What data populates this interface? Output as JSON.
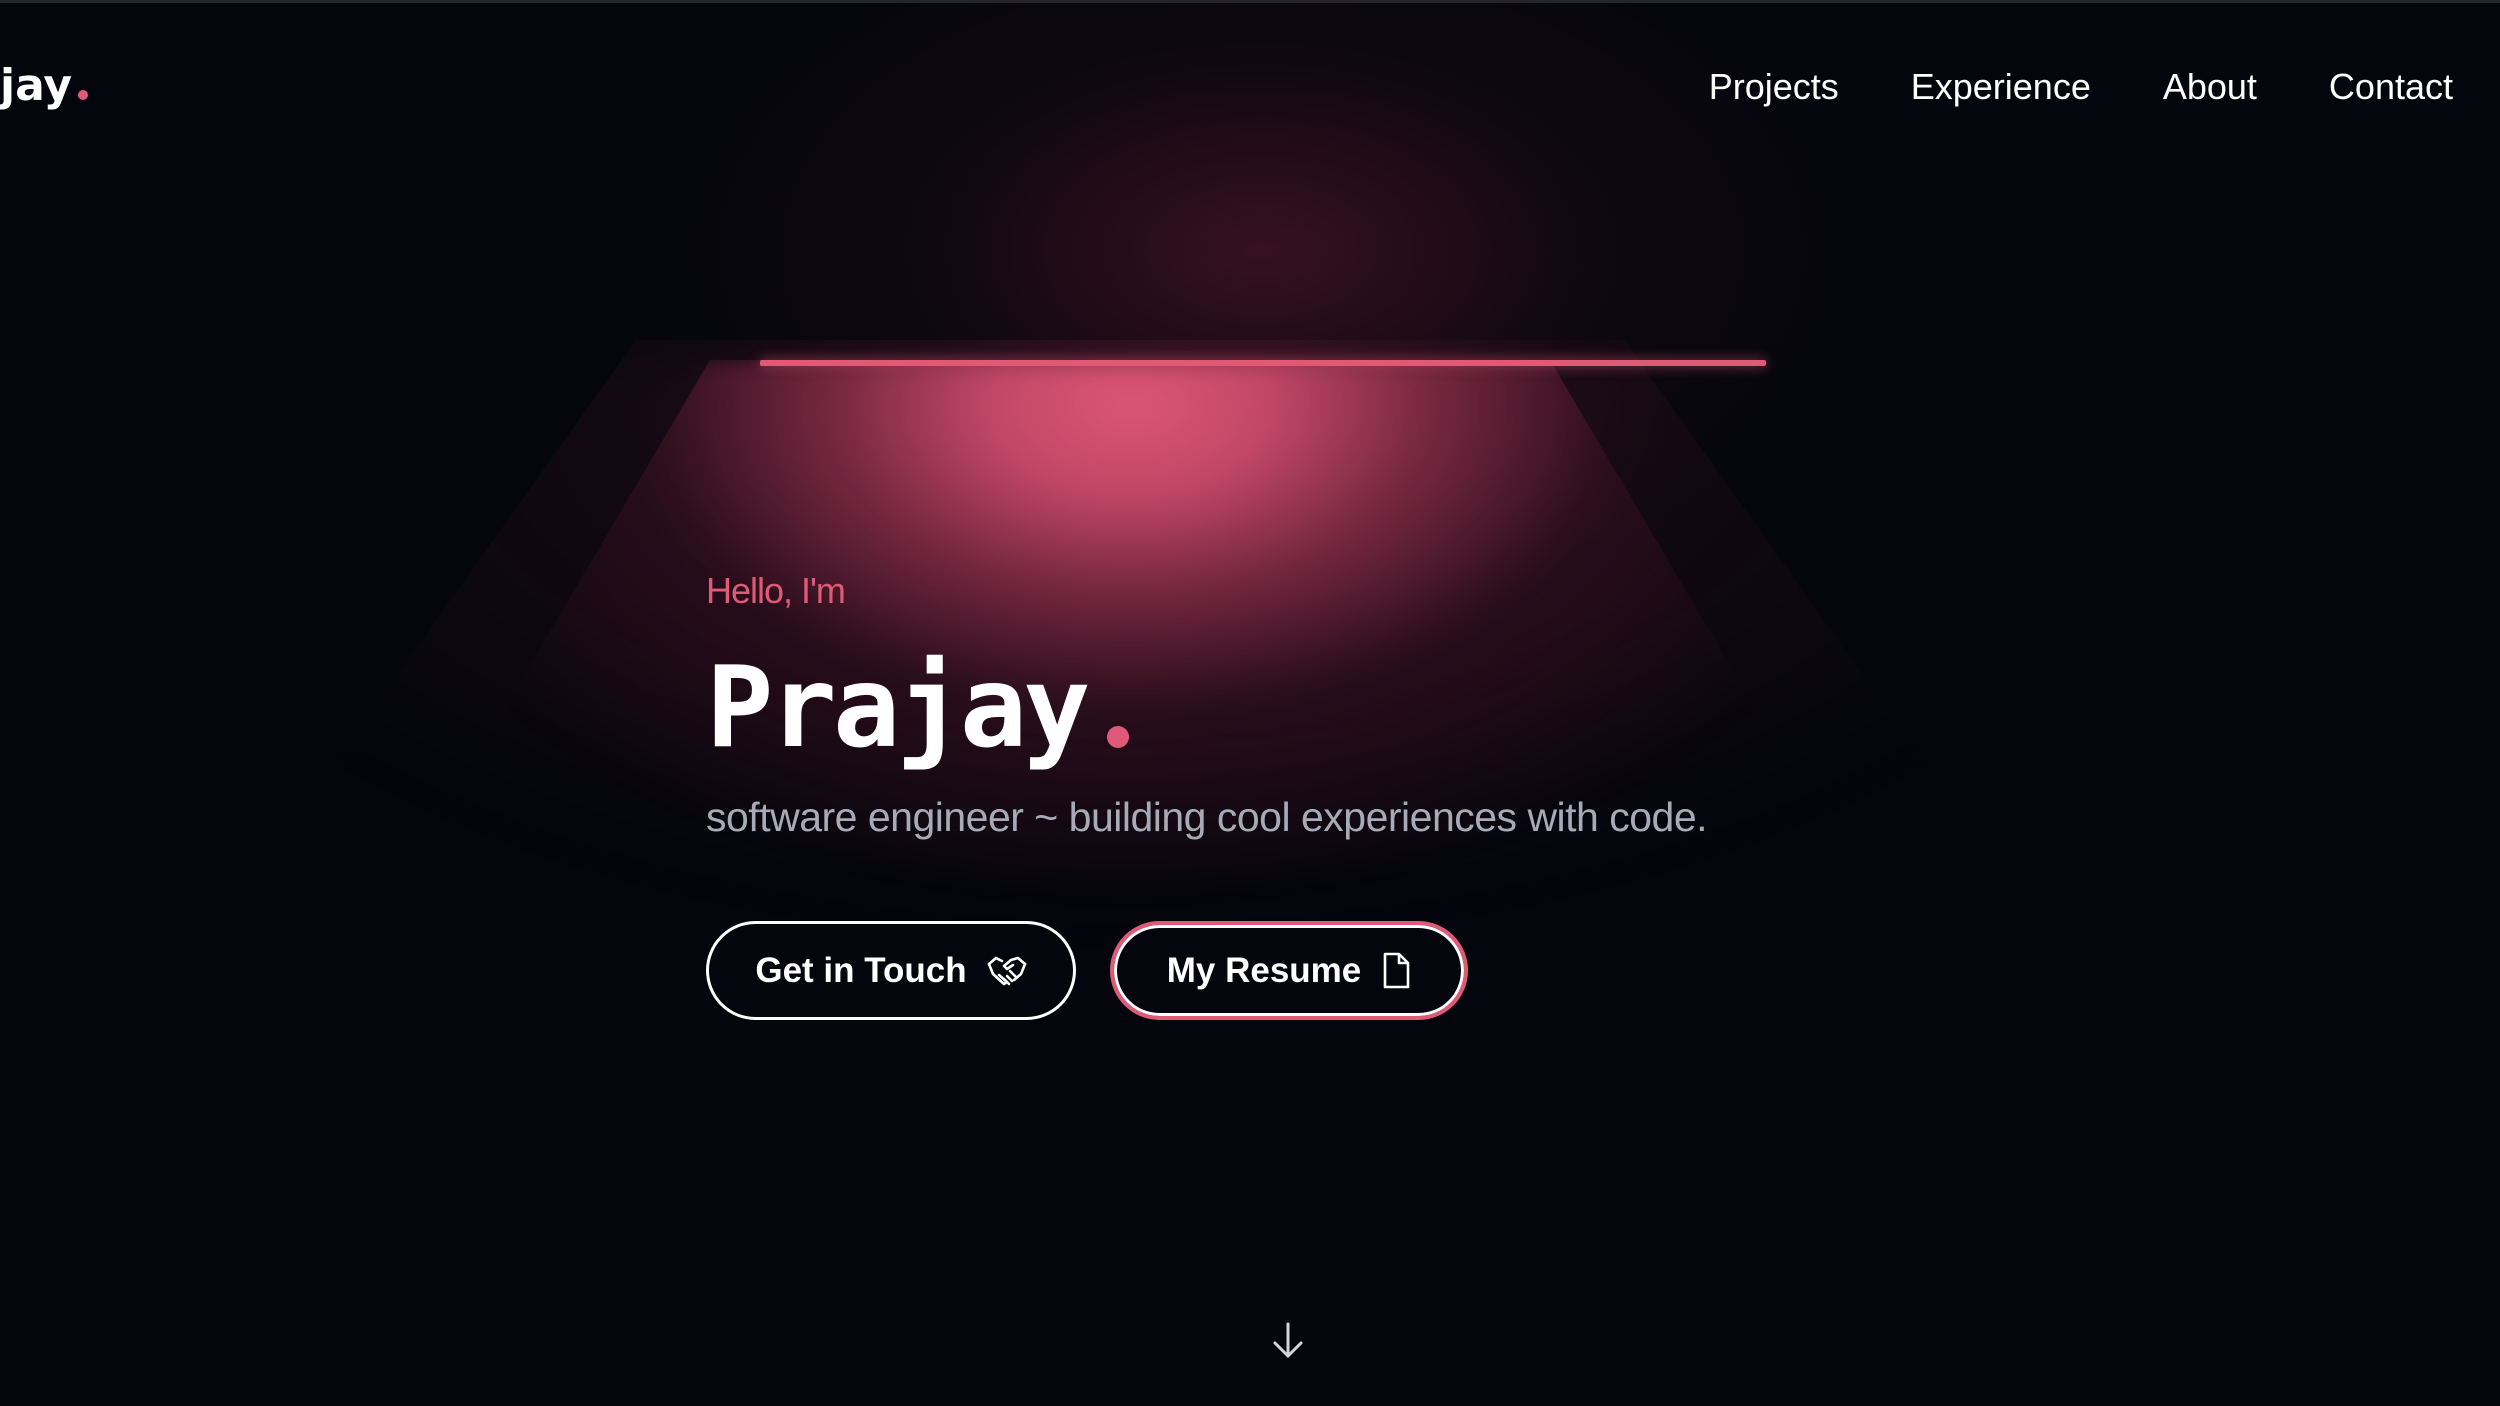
{
  "header": {
    "brand_text": "jay",
    "nav": [
      {
        "label": "Projects"
      },
      {
        "label": "Experience"
      },
      {
        "label": "About"
      },
      {
        "label": "Contact"
      }
    ]
  },
  "hero": {
    "greeting": "Hello, I'm",
    "name": "Prajay",
    "tagline": "software engineer ~ building cool experiences with code."
  },
  "buttons": {
    "get_in_touch": {
      "label": "Get in Touch",
      "icon": "handshake-icon"
    },
    "my_resume": {
      "label": "My Resume",
      "icon": "document-icon"
    }
  },
  "scroll_indicator": {
    "icon": "arrow-down-icon"
  },
  "colors": {
    "background": "#05060d",
    "accent": "#e05a78",
    "muted_text": "#a7abb8"
  }
}
